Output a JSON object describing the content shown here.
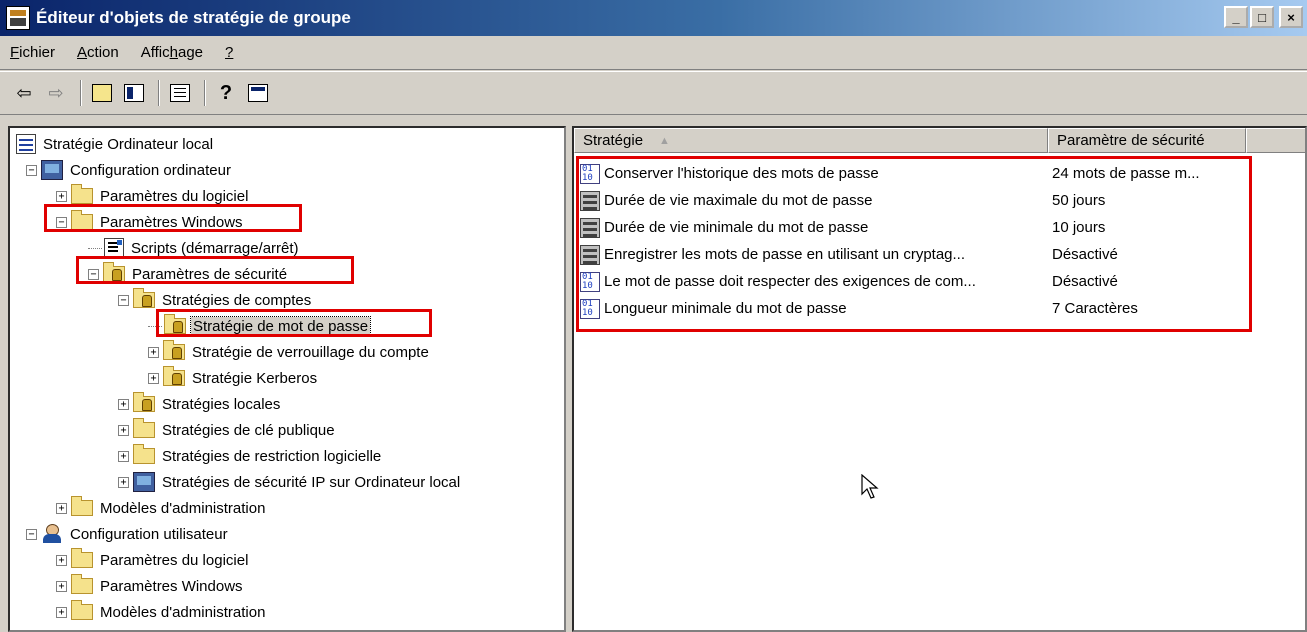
{
  "window": {
    "title": "Éditeur d'objets de stratégie de groupe",
    "minimize": "_",
    "maximize": "□",
    "close": "×"
  },
  "menu": [
    {
      "pre": "",
      "u": "F",
      "post": "ichier"
    },
    {
      "pre": "",
      "u": "A",
      "post": "ction"
    },
    {
      "pre": "Affic",
      "u": "h",
      "post": "age"
    },
    {
      "pre": "",
      "u": "?",
      "post": ""
    }
  ],
  "toolbar": {
    "back_icon": "⇦",
    "forward_icon": "⇨"
  },
  "tree": [
    {
      "label": "Stratégie Ordinateur local",
      "icon": "policy"
    },
    {
      "label": "Configuration ordinateur",
      "icon": "computer",
      "expander": "−"
    },
    {
      "label": "Paramètres du logiciel",
      "icon": "folder",
      "expander": "+"
    },
    {
      "label": "Paramètres Windows",
      "icon": "folder",
      "expander": "−"
    },
    {
      "label": "Scripts (démarrage/arrêt)",
      "icon": "script"
    },
    {
      "label": "Paramètres de sécurité",
      "icon": "lock-folder",
      "expander": "−"
    },
    {
      "label": "Stratégies de comptes",
      "icon": "lock-folder",
      "expander": "−"
    },
    {
      "label": "Stratégie de mot de passe",
      "icon": "lock-folder"
    },
    {
      "label": "Stratégie de verrouillage du compte",
      "icon": "lock-folder",
      "expander": "+"
    },
    {
      "label": "Stratégie Kerberos",
      "icon": "lock-folder",
      "expander": "+"
    },
    {
      "label": "Stratégies locales",
      "icon": "lock-folder",
      "expander": "+"
    },
    {
      "label": "Stratégies de clé publique",
      "icon": "folder",
      "expander": "+"
    },
    {
      "label": "Stratégies de restriction logicielle",
      "icon": "folder",
      "expander": "+"
    },
    {
      "label": "Stratégies de sécurité IP sur Ordinateur local",
      "icon": "computer",
      "expander": "+"
    },
    {
      "label": "Modèles d'administration",
      "icon": "folder",
      "expander": "+"
    },
    {
      "label": "Configuration utilisateur",
      "icon": "user",
      "expander": "−"
    },
    {
      "label": "Paramètres du logiciel",
      "icon": "folder",
      "expander": "+"
    },
    {
      "label": "Paramètres Windows",
      "icon": "folder",
      "expander": "+"
    },
    {
      "label": "Modèles d'administration",
      "icon": "folder",
      "expander": "+"
    }
  ],
  "list": {
    "columns": [
      "Stratégie",
      "Paramètre de sécurité"
    ],
    "rows": [
      {
        "name": "Conserver l'historique des mots de passe",
        "value": "24 mots de passe m...",
        "icon": "bin"
      },
      {
        "name": "Durée de vie maximale du mot de passe",
        "value": "50 jours",
        "icon": "srv"
      },
      {
        "name": "Durée de vie minimale du mot de passe",
        "value": "10 jours",
        "icon": "srv"
      },
      {
        "name": "Enregistrer les mots de passe en utilisant un cryptag...",
        "value": "Désactivé",
        "icon": "srv"
      },
      {
        "name": "Le mot de passe doit respecter des exigences de com...",
        "value": "Désactivé",
        "icon": "bin"
      },
      {
        "name": "Longueur minimale du mot de passe",
        "value": "7 Caractères",
        "icon": "bin"
      }
    ]
  },
  "colors": {
    "highlight_box": "#e00000",
    "titlebar": "#0a246a"
  }
}
